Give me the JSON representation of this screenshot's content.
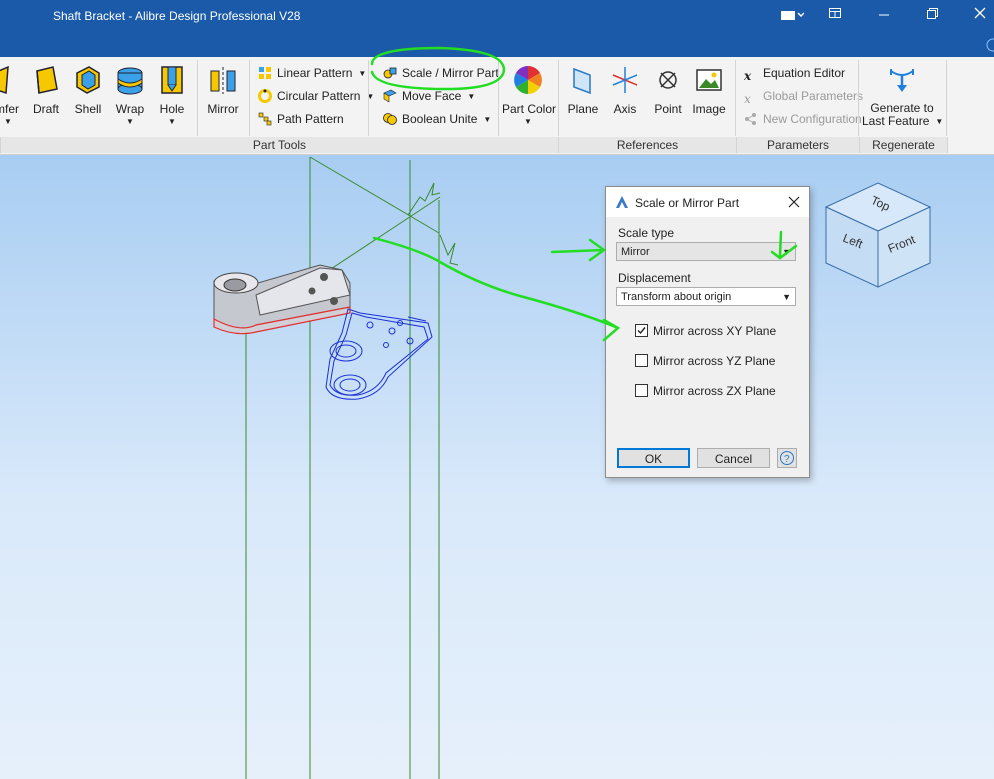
{
  "window": {
    "title": "Shaft Bracket - Alibre Design Professional V28",
    "controls": [
      "minimize-icon",
      "maximize-icon",
      "close-icon"
    ]
  },
  "ribbon": {
    "part_features": {
      "chamfer_partial": "mfer",
      "draft": "Draft",
      "shell": "Shell",
      "wrap": "Wrap",
      "hole": "Hole",
      "mirror": "Mirror"
    },
    "patterns": {
      "linear": "Linear Pattern",
      "circular": "Circular Pattern",
      "path": "Path Pattern"
    },
    "modify": {
      "scale_mirror": "Scale / Mirror Part",
      "move_face": "Move Face",
      "boolean_unite": "Boolean Unite"
    },
    "part_color": "Part Color",
    "references": {
      "plane": "Plane",
      "axis": "Axis",
      "point": "Point",
      "image": "Image"
    },
    "parameters": {
      "equation_editor": "Equation Editor",
      "global_parameters": "Global Parameters",
      "new_configuration": "New Configuration"
    },
    "regenerate": {
      "line1": "Generate to",
      "line2": "Last Feature"
    },
    "groups": {
      "part_tools": "Part Tools",
      "references": "References",
      "parameters": "Parameters",
      "regenerate": "Regenerate"
    }
  },
  "dialog": {
    "title": "Scale or Mirror Part",
    "scale_type_label": "Scale type",
    "scale_type_value": "Mirror",
    "displacement_label": "Displacement",
    "displacement_value": "Transform about origin",
    "options": [
      {
        "label": "Mirror across XY Plane",
        "checked": true
      },
      {
        "label": "Mirror across YZ Plane",
        "checked": false
      },
      {
        "label": "Mirror across ZX Plane",
        "checked": false
      }
    ],
    "ok": "OK",
    "cancel": "Cancel",
    "help_icon": "help-icon"
  },
  "view_cube": {
    "top": "Top",
    "left": "Left",
    "front": "Front"
  },
  "colors": {
    "title_bar": "#1a5aa8",
    "annotation_green": "#22dd22",
    "mirror_preview_blue": "#1a2fd6",
    "part_edge_red": "#e03030",
    "plane_green": "#3a8a2a"
  }
}
